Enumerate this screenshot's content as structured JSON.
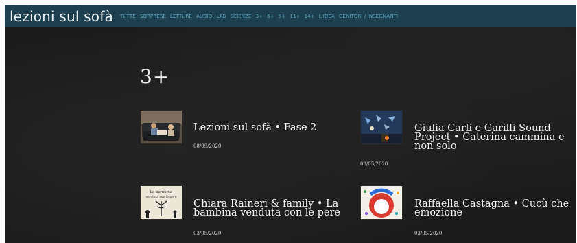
{
  "header": {
    "site_title": "lezioni sul sofà",
    "nav": [
      "TUTTE",
      "SORPRESE",
      "LETTURE",
      "AUDIO",
      "LAB",
      "SCIENZE",
      "3+",
      "6+",
      "9+",
      "11+",
      "14+",
      "L'IDEA",
      "GENITORI / INSEGNANTI"
    ]
  },
  "main": {
    "heading": "3+",
    "cards": [
      {
        "title": "Lezioni sul sofà • Fase 2",
        "date": "08/05/2020",
        "thumb_icon": "couch-reading-photo"
      },
      {
        "title": "Giulia Carli e Garilli Sound Project • Caterina cammina e non solo",
        "date": "03/05/2020",
        "thumb_icon": "stage-performance-photo"
      },
      {
        "title": "Chiara Raineri & family • La bambina venduta con le pere",
        "date": "03/05/2020",
        "thumb_icon": "book-cover-photo",
        "thumb_text": [
          "La bambina",
          "venduta con le pere"
        ]
      },
      {
        "title": "Raffaella Castagna • Cucù che emozione",
        "date": "03/05/2020",
        "thumb_icon": "colorful-illustration-photo"
      }
    ]
  },
  "colors": {
    "topbar": "#1d3f4f",
    "nav_text": "#5fa6bd",
    "background": "#1c1c1c"
  }
}
